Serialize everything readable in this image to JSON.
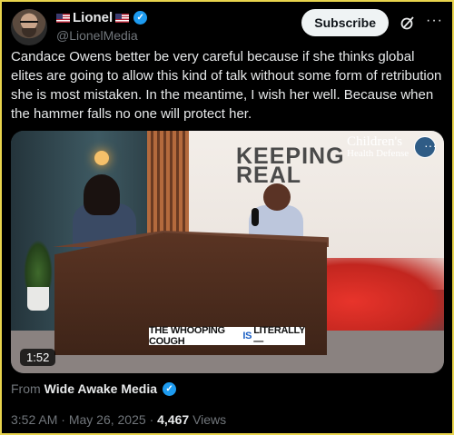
{
  "author": {
    "display_name": "Lionel",
    "handle": "@LionelMedia",
    "verified_icon": "verified-badge-icon",
    "flag_icon": "us-flag-icon"
  },
  "actions": {
    "subscribe_label": "Subscribe",
    "grok_icon": "grok-icon",
    "more_label": "···"
  },
  "tweet": {
    "text": "Candace Owens better be very careful because if she thinks global elites are going to allow this kind of talk without some form of retribution she is most mistaken. In the meantime, I wish her well. Because when the hammer falls no one will protect her."
  },
  "video": {
    "screen_title_line1": "KEEPING",
    "screen_title_line2": "REAL",
    "brand_line1": "Children's",
    "brand_line2": "Health Defense",
    "caption_before": "THE WHOOPING COUGH",
    "caption_highlight": "IS",
    "caption_after": "LITERALLY—",
    "duration": "1:52",
    "more_label": "···"
  },
  "source": {
    "prefix": "From",
    "name": "Wide Awake Media"
  },
  "meta": {
    "time": "3:52 AM",
    "date": "May 26, 2025",
    "separator": "·",
    "views_count": "4,467",
    "views_label": "Views"
  },
  "colors": {
    "accent": "#1d9bf0",
    "frame_border": "#e8d44d",
    "background": "#000000"
  }
}
